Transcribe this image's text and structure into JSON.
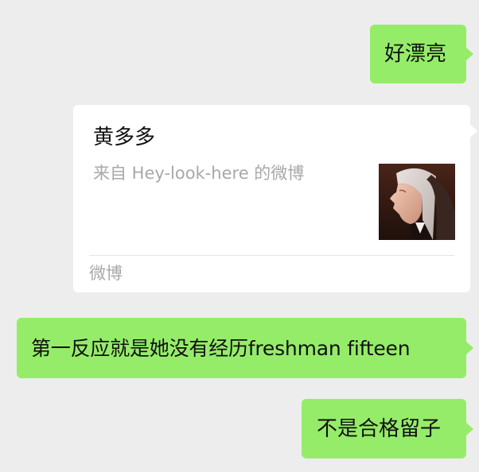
{
  "messages": [
    {
      "id": "msg1",
      "type": "text",
      "side": "right",
      "text": "好漂亮"
    },
    {
      "id": "msg2",
      "type": "link-card",
      "side": "right",
      "title": "黄多多",
      "description": "来自 Hey-look-here 的微博",
      "thumbnail": "portrait-photo",
      "source": "微博"
    },
    {
      "id": "msg3",
      "type": "text",
      "side": "right",
      "text": "第一反应就是她没有经历freshman fifteen"
    },
    {
      "id": "msg4",
      "type": "text",
      "side": "right",
      "text": "不是合格留子"
    }
  ],
  "colors": {
    "background": "#ededed",
    "bubble_green": "#95ec69",
    "card_white": "#ffffff",
    "text_primary": "#111111",
    "text_secondary": "#a8a8a8"
  }
}
